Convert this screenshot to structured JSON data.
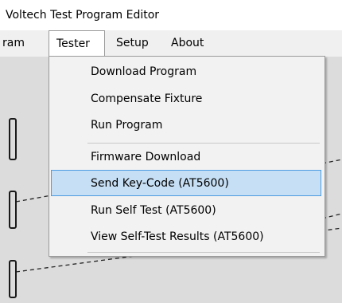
{
  "window": {
    "title": "Voltech Test Program Editor"
  },
  "menubar": {
    "items": [
      {
        "label": "ram",
        "active": false
      },
      {
        "label": "Tester",
        "active": true
      },
      {
        "label": "Setup",
        "active": false
      },
      {
        "label": "About",
        "active": false
      }
    ]
  },
  "tester_menu": {
    "groups": [
      [
        "Download Program",
        "Compensate Fixture",
        "Run Program"
      ],
      [
        "Firmware Download",
        "Send Key-Code (AT5600)",
        "Run Self Test (AT5600)",
        "View Self-Test Results (AT5600)"
      ]
    ],
    "highlighted": "Send Key-Code (AT5600)"
  },
  "colors": {
    "highlight_fill": "#c6dff5",
    "highlight_border": "#4c9ce0",
    "menu_bg": "#f2f2f2",
    "canvas_bg": "#dcdcdc"
  }
}
